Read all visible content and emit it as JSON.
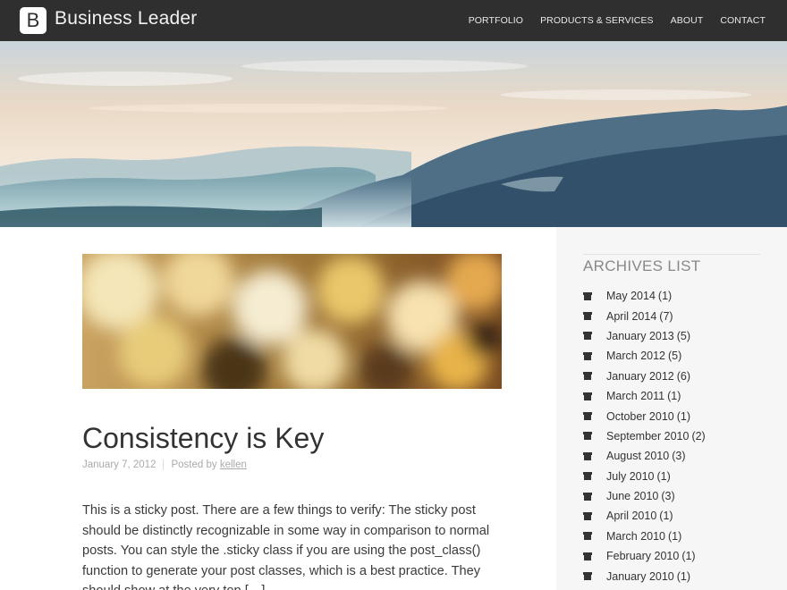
{
  "header": {
    "logo_letter": "B",
    "site_title": "Business Leader",
    "nav": [
      "PORTFOLIO",
      "PRODUCTS & SERVICES",
      "ABOUT",
      "CONTACT"
    ]
  },
  "post": {
    "title": "Consistency is Key",
    "date": "January 7, 2012",
    "posted_by_label": "Posted by",
    "author": "kellen",
    "excerpt": "This is a sticky post. There are a few things to verify: The sticky post should be distinctly recognizable in some way in comparison to normal posts. You can style the .sticky class if you are using the post_class() function to generate your post classes, which is a best practice. They should show at the very top […]"
  },
  "sidebar": {
    "widget_title": "ARCHIVES LIST",
    "archives": [
      {
        "label": "May 2014",
        "count": "(1)"
      },
      {
        "label": "April 2014",
        "count": "(7)"
      },
      {
        "label": "January 2013",
        "count": "(5)"
      },
      {
        "label": "March 2012",
        "count": "(5)"
      },
      {
        "label": "January 2012",
        "count": "(6)"
      },
      {
        "label": "March 2011",
        "count": "(1)"
      },
      {
        "label": "October 2010",
        "count": "(1)"
      },
      {
        "label": "September 2010",
        "count": "(2)"
      },
      {
        "label": "August 2010",
        "count": "(3)"
      },
      {
        "label": "July 2010",
        "count": "(1)"
      },
      {
        "label": "June 2010",
        "count": "(3)"
      },
      {
        "label": "April 2010",
        "count": "(1)"
      },
      {
        "label": "March 2010",
        "count": "(1)"
      },
      {
        "label": "February 2010",
        "count": "(1)"
      },
      {
        "label": "January 2010",
        "count": "(1)"
      }
    ]
  },
  "colors": {
    "topbar": "#2f2f2f",
    "sidebar_bg": "#f6f6f6",
    "text": "#333333",
    "meta": "#aaaaaa"
  },
  "icons": {
    "archive_item": "archive-box-icon"
  }
}
